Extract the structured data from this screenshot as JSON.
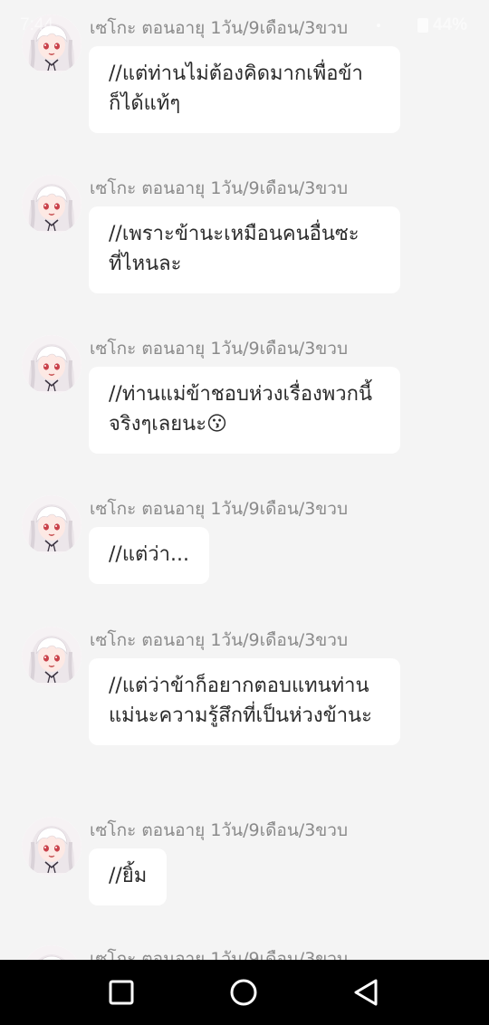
{
  "status_bar": {
    "time": "7:44",
    "battery": "44%"
  },
  "sender_name": "เซโกะ ตอนอายุ 1วัน/9เดือน/3ขวบ",
  "messages": [
    {
      "text": "//แต่ท่านไม่ต้องคิดมากเพื่อข้าก็ได้แท้ๆ"
    },
    {
      "text": "//เพราะข้านะเหมือนคนอื่นซะที่ไหนละ"
    },
    {
      "text": "//ท่านแม่ข้าชอบห่วงเรื่องพวกนี้จริงๆเลยนะ😗"
    },
    {
      "text": "//แต่ว่า..."
    },
    {
      "text": "//แต่ว่าข้าก็อยากตอบแทนท่านแม่นะความรู้สึกที่เป็นห่วงข้านะ"
    },
    {
      "text": "//ยิ้ม"
    }
  ],
  "colors": {
    "background": "#f4f4f4",
    "bubble": "#ffffff",
    "text": "#2b2b2b",
    "name": "#8a8a8a",
    "nav_bar": "#000000"
  },
  "nav": {
    "recents": "square-icon",
    "home": "circle-icon",
    "back": "triangle-back-icon"
  }
}
